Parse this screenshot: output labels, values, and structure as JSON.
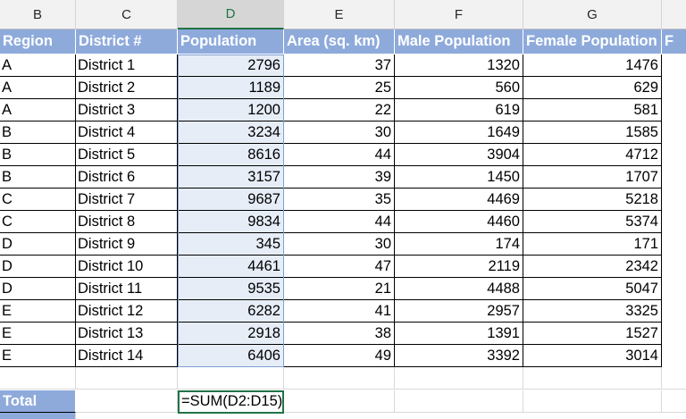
{
  "columns": [
    "B",
    "C",
    "D",
    "E",
    "F",
    "G"
  ],
  "active_column": "D",
  "headers": {
    "region": "Region",
    "district": "District #",
    "population": "Population",
    "area": "Area (sq. km)",
    "male": "Male Population",
    "female": "Female Population",
    "partial_h": "F"
  },
  "rows": [
    {
      "region": "A",
      "district": "District 1",
      "population": "2796",
      "area": "37",
      "male": "1320",
      "female": "1476"
    },
    {
      "region": "A",
      "district": "District 2",
      "population": "1189",
      "area": "25",
      "male": "560",
      "female": "629"
    },
    {
      "region": "A",
      "district": "District 3",
      "population": "1200",
      "area": "22",
      "male": "619",
      "female": "581"
    },
    {
      "region": "B",
      "district": "District 4",
      "population": "3234",
      "area": "30",
      "male": "1649",
      "female": "1585"
    },
    {
      "region": "B",
      "district": "District 5",
      "population": "8616",
      "area": "44",
      "male": "3904",
      "female": "4712"
    },
    {
      "region": "B",
      "district": "District 6",
      "population": "3157",
      "area": "39",
      "male": "1450",
      "female": "1707"
    },
    {
      "region": "C",
      "district": "District 7",
      "population": "9687",
      "area": "35",
      "male": "4469",
      "female": "5218"
    },
    {
      "region": "C",
      "district": "District 8",
      "population": "9834",
      "area": "44",
      "male": "4460",
      "female": "5374"
    },
    {
      "region": "D",
      "district": "District 9",
      "population": "345",
      "area": "30",
      "male": "174",
      "female": "171"
    },
    {
      "region": "D",
      "district": "District 10",
      "population": "4461",
      "area": "47",
      "male": "2119",
      "female": "2342"
    },
    {
      "region": "D",
      "district": "District 11",
      "population": "9535",
      "area": "21",
      "male": "4488",
      "female": "5047"
    },
    {
      "region": "E",
      "district": "District 12",
      "population": "6282",
      "area": "41",
      "male": "2957",
      "female": "3325"
    },
    {
      "region": "E",
      "district": "District 13",
      "population": "2918",
      "area": "38",
      "male": "1391",
      "female": "1527"
    },
    {
      "region": "E",
      "district": "District 14",
      "population": "6406",
      "area": "49",
      "male": "3392",
      "female": "3014"
    }
  ],
  "total": {
    "label": "Total",
    "formula": "=SUM(D2:D15)"
  },
  "colors": {
    "header_fill": "#8eaadb",
    "selection_fill": "#e6edf7",
    "active_accent": "#217346"
  }
}
